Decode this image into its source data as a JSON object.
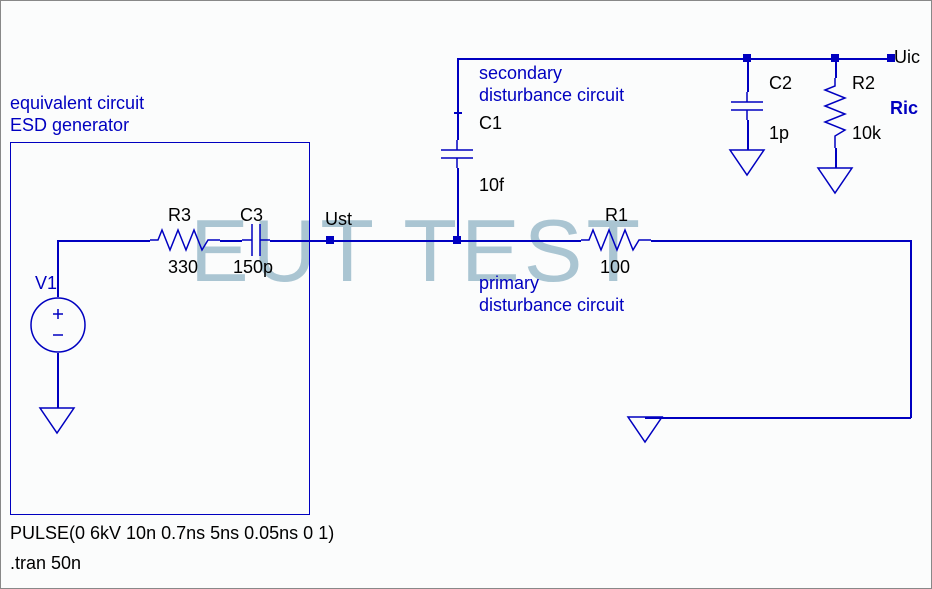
{
  "title_lines": {
    "line1": "equivalent circuit",
    "line2": "ESD generator"
  },
  "secondary_label": {
    "line1": "secondary",
    "line2": "disturbance circuit"
  },
  "primary_label": {
    "line1": "primary",
    "line2": "disturbance circuit"
  },
  "components": {
    "V1": {
      "name": "V1"
    },
    "R3": {
      "name": "R3",
      "value": "330"
    },
    "C3": {
      "name": "C3",
      "value": "150p"
    },
    "R1": {
      "name": "R1",
      "value": "100"
    },
    "C1": {
      "name": "C1",
      "value": "10f"
    },
    "C2": {
      "name": "C2",
      "value": "1p"
    },
    "R2": {
      "name": "R2",
      "value": "10k"
    },
    "Ric": {
      "name": "Ric"
    }
  },
  "nets": {
    "Ust": "Ust",
    "Uic": "Uic"
  },
  "spice": {
    "pulse": "PULSE(0 6kV 10n 0.7ns 5ns 0.05ns 0 1)",
    "tran": ".tran 50n"
  },
  "watermark": "EUT TEST"
}
